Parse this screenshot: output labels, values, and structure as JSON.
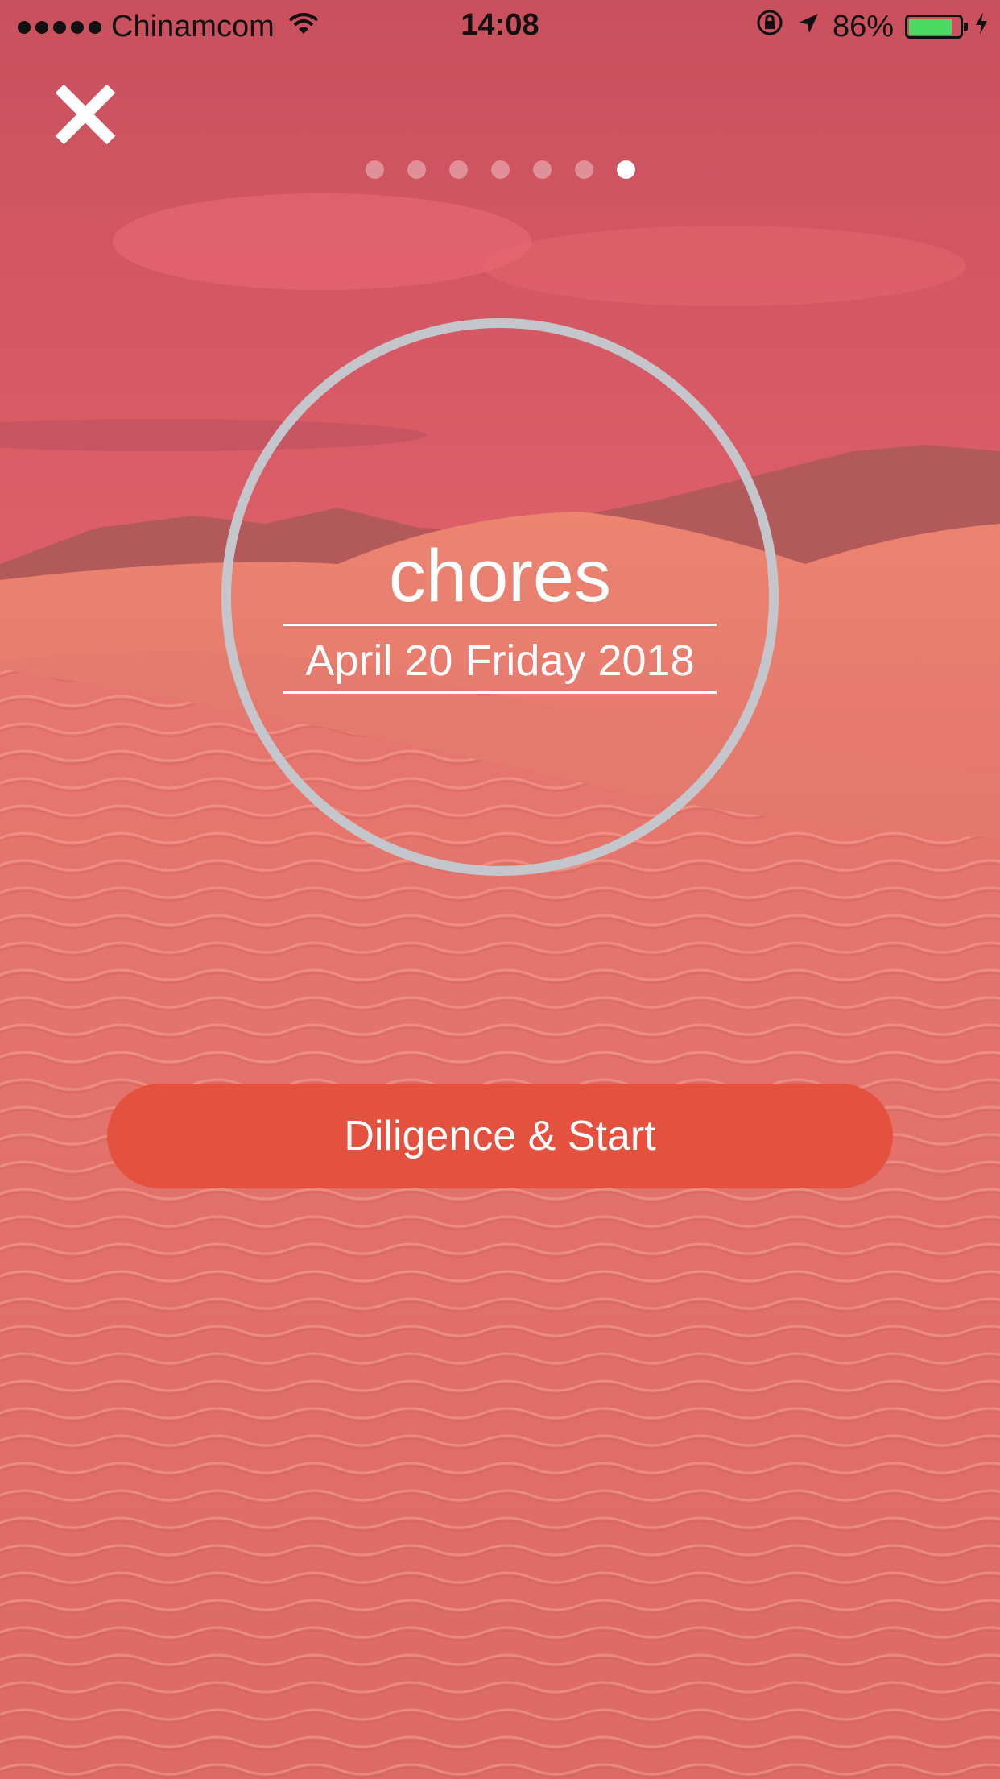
{
  "status_bar": {
    "carrier": "Chinamcom",
    "time": "14:08",
    "battery": "86%",
    "battery_level": 0.86,
    "icons": [
      "signal-dots-icon",
      "wifi-icon",
      "orientation-lock-icon",
      "location-arrow-icon",
      "battery-icon",
      "charging-bolt-icon"
    ]
  },
  "header": {
    "close_icon": "close-icon"
  },
  "pager": {
    "count": 7,
    "active_index": 6
  },
  "task": {
    "title": "chores",
    "date": "April 20 Friday 2018"
  },
  "action": {
    "start_label": "Diligence & Start",
    "color": "#e4513e"
  },
  "theme": {
    "background": "desert-dunes-pink",
    "ring_color": "#c4c6cc",
    "battery_color": "#4cd964"
  }
}
